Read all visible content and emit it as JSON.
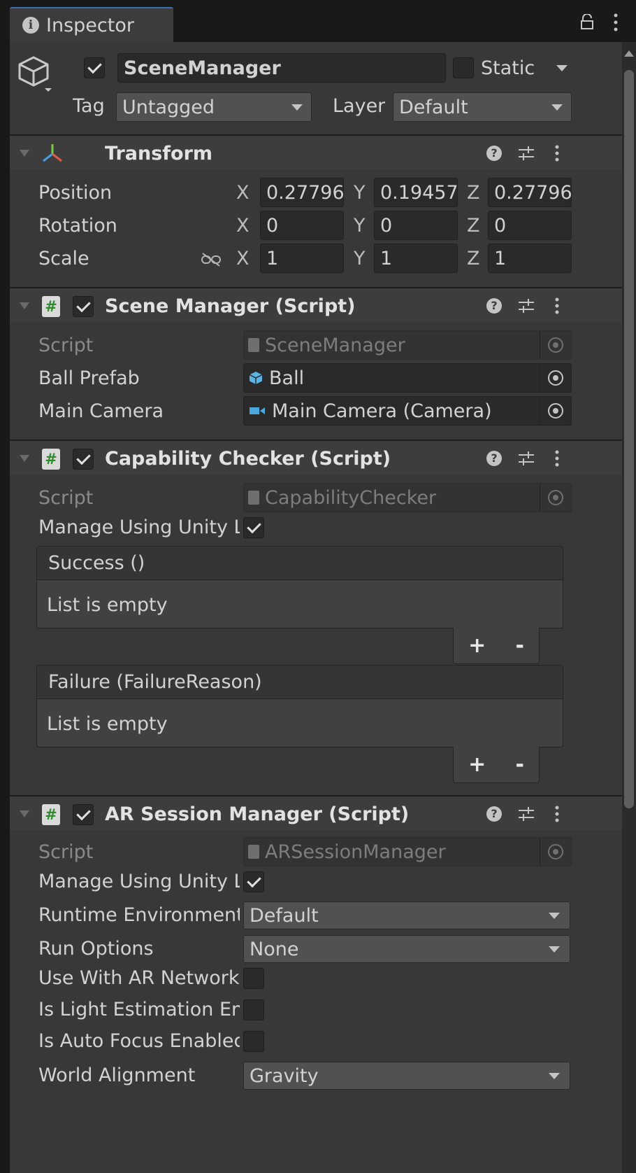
{
  "tab": {
    "title": "Inspector"
  },
  "gameobject": {
    "active": true,
    "name": "SceneManager",
    "static_label": "Static",
    "static": false,
    "tag_label": "Tag",
    "tag_value": "Untagged",
    "layer_label": "Layer",
    "layer_value": "Default"
  },
  "transform": {
    "title": "Transform",
    "rows": [
      {
        "label": "Position",
        "x": "0.27796",
        "y": "0.19457",
        "z": "0.27796"
      },
      {
        "label": "Rotation",
        "x": "0",
        "y": "0",
        "z": "0"
      },
      {
        "label": "Scale",
        "x": "1",
        "y": "1",
        "z": "1"
      }
    ],
    "axis": {
      "x": "X",
      "y": "Y",
      "z": "Z"
    }
  },
  "scene_manager": {
    "title": "Scene Manager (Script)",
    "enabled": true,
    "script_label": "Script",
    "script_value": "SceneManager",
    "ball_label": "Ball Prefab",
    "ball_value": "Ball",
    "camera_label": "Main Camera",
    "camera_value": "Main Camera (Camera)"
  },
  "capability_checker": {
    "title": "Capability Checker (Script)",
    "enabled": true,
    "script_label": "Script",
    "script_value": "CapabilityChecker",
    "manage_label": "Manage Using Unity Lifecycle",
    "manage_value": true,
    "success_header": "Success ()",
    "success_empty": "List is empty",
    "failure_header": "Failure (FailureReason)",
    "failure_empty": "List is empty",
    "plus": "+",
    "minus": "-"
  },
  "ar_session_manager": {
    "title": "AR Session Manager (Script)",
    "enabled": true,
    "script_label": "Script",
    "script_value": "ARSessionManager",
    "manage_label": "Manage Using Unity Lifecycle",
    "manage_value": true,
    "runtime_label": "Runtime Environment",
    "runtime_value": "Default",
    "run_options_label": "Run Options",
    "run_options_value": "None",
    "network_label": "Use With AR Networking",
    "network_value": false,
    "light_label": "Is Light Estimation Enabled",
    "light_value": false,
    "autofocus_label": "Is Auto Focus Enabled",
    "autofocus_value": false,
    "world_label": "World Alignment",
    "world_value": "Gravity"
  },
  "colors": {
    "accent": "#3a72b0",
    "panel": "#383838",
    "field": "#2a2a2a",
    "script_green": "#2e8b2e",
    "prefab_blue": "#5ab4e6",
    "camera_blue": "#4aa8e0"
  }
}
